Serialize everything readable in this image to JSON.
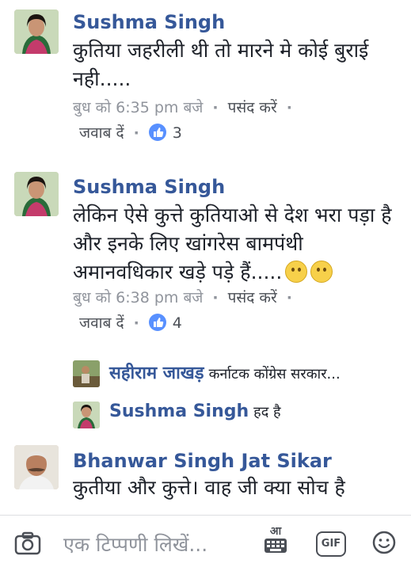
{
  "comments": [
    {
      "name": "Sushma Singh",
      "text": "कुतिया जहरीली थी तो मारने मे कोई बुराई नही.....",
      "time": "बुध को 6:35 pm बजे",
      "like_label": "पसंद करें",
      "reply_label": "जवाब दें",
      "like_count": "3"
    },
    {
      "name": "Sushma Singh",
      "text": "लेकिन ऐसे कुत्ते कुतियाओ से देश भरा पड़ा है और इनके लिए खांगरेस बामपंथी अमानवधिकार खड़े पड़े हैं.....",
      "time": "बुध को 6:38 pm बजे",
      "like_label": "पसंद करें",
      "reply_label": "जवाब दें",
      "like_count": "4"
    },
    {
      "name": "Bhanwar Singh Jat Sikar",
      "text": "कुतीया और कुत्ते। वाह जी क्या सोच है"
    }
  ],
  "replies": [
    {
      "name": "सहीराम जाखड़",
      "text": "कर्नाटक कोंग्रेस सरकार..."
    },
    {
      "name": "Sushma Singh",
      "text": "हद है"
    }
  ],
  "composer": {
    "placeholder": "एक टिप्पणी लिखें...",
    "keyboard_label": "आ",
    "gif_label": "GIF"
  },
  "colors": {
    "name": "#365899",
    "meta": "#90949c",
    "like_badge": "#5890ff"
  }
}
